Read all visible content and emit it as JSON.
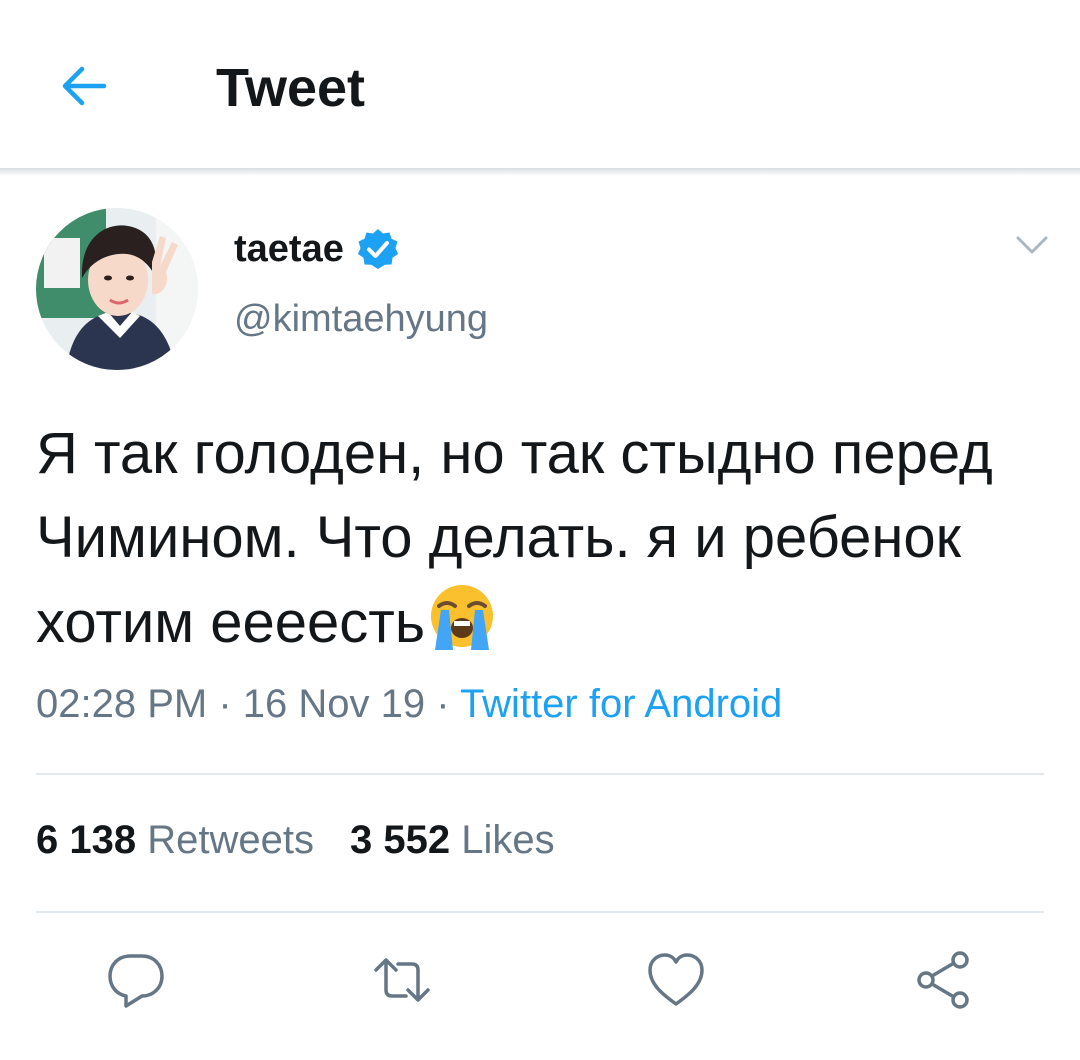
{
  "header": {
    "title": "Tweet",
    "back_icon": "arrow-left-icon",
    "accent": "#1da1f2"
  },
  "tweet": {
    "display_name": "taetae",
    "verified_icon": "verified-badge-icon",
    "handle": "@kimtaehyung",
    "text": "Я так голоден, но так стыдно перед Чимином. Что делать. я и ребенок хотим еееесть",
    "emoji": "loudly-crying-face",
    "time": "02:28 PM",
    "separator": " · ",
    "date": "16 Nov 19",
    "source": "Twitter for Android"
  },
  "stats": {
    "retweets_count": "6 138",
    "retweets_label": "Retweets",
    "likes_count": "3 552",
    "likes_label": "Likes"
  },
  "actions": [
    "reply-icon",
    "retweet-icon",
    "like-icon",
    "share-icon"
  ],
  "colors": {
    "text": "#14171a",
    "secondary": "#657786",
    "link": "#1da1f2",
    "divider": "#e1e8ed"
  }
}
